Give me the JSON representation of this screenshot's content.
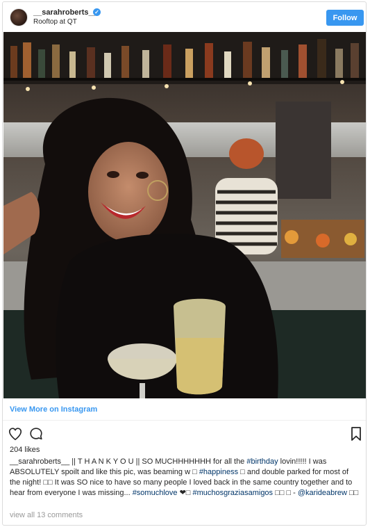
{
  "post": {
    "username": "__sarahroberts__",
    "verified_mark": "✓",
    "location": "Rooftop at QT",
    "follow_label": "Follow",
    "view_more_label": "View More on Instagram",
    "likes": "204 likes",
    "caption": {
      "user": "__sarahroberts__",
      "t1": " || T H A N K Y O U || SO MUCHHHHHHH for all the ",
      "h1": "#birthday",
      "t2": " lovin!!!!! I was ABSOLUTELY spoilt and like this pic, was beaming w □ ",
      "h2": "#happiness",
      "t3": " □ and double parked for most of the night! □□ It was SO nice to have so many people I loved back in the same country together and to hear from everyone I was missing... ",
      "h3": "#somuchlove",
      "t4": " ❤□ ",
      "h4": "#mucho​sgraziasamigos",
      "t5": " □□ □ - ",
      "h5": "@karideabrew",
      "t6": " □□"
    },
    "view_comments_label": "view all 13 comments"
  },
  "icons": {
    "avatar": "avatar",
    "like": "heart-icon",
    "comment": "comment-icon",
    "save": "bookmark-icon"
  },
  "colors": {
    "accent": "#3897f0",
    "hashtag": "#003569",
    "muted": "#999999",
    "border": "#dbdbdb"
  }
}
